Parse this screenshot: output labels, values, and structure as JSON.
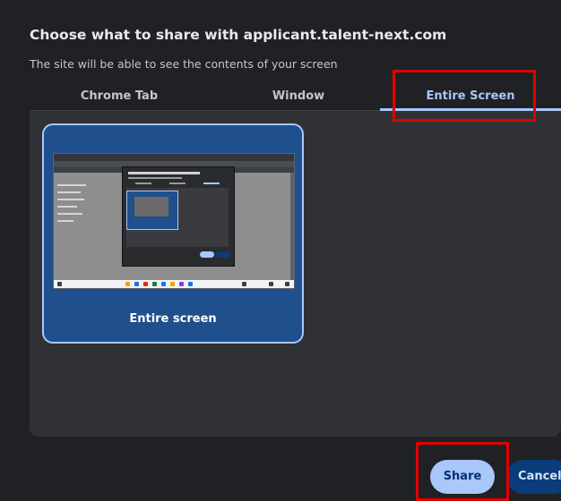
{
  "dialog": {
    "title": "Choose what to share with applicant.talent-next.com",
    "subtitle": "The site will be able to see the contents of your screen"
  },
  "tabs": [
    {
      "label": "Chrome Tab",
      "selected": false
    },
    {
      "label": "Window",
      "selected": false
    },
    {
      "label": "Entire Screen",
      "selected": true
    }
  ],
  "screens": [
    {
      "label": "Entire screen",
      "selected": true
    }
  ],
  "buttons": {
    "share_label": "Share",
    "cancel_label": "Cancel"
  },
  "colors": {
    "background": "#202124",
    "panel": "#303134",
    "accent": "#a8c7fa",
    "selected_card": "#1f4f8c",
    "highlight_box": "#e00000"
  }
}
